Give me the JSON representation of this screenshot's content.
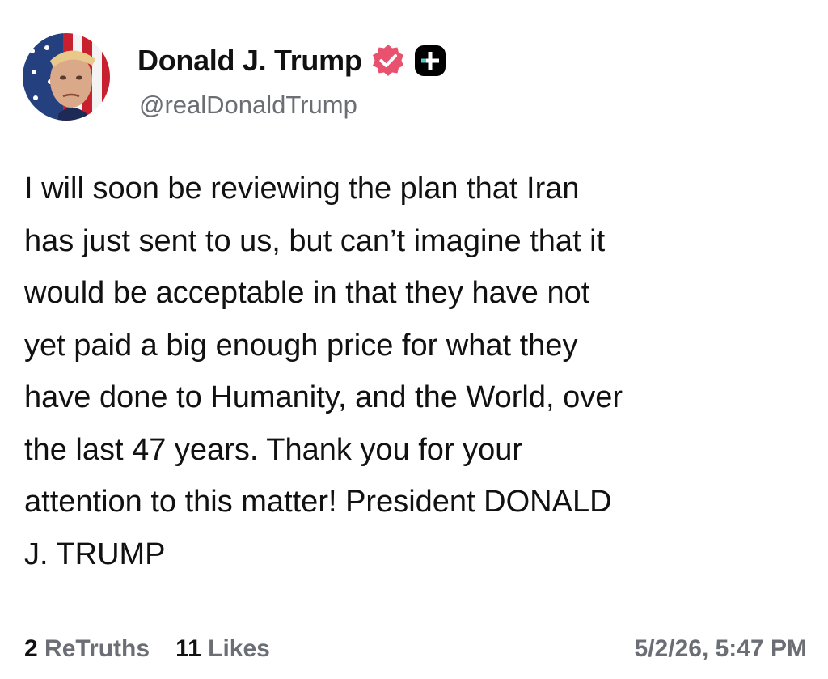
{
  "author": {
    "display_name": "Donald J. Trump",
    "handle": "@realDonaldTrump",
    "verified_badge_icon": "verified-badge-icon",
    "verified_badge_color": "#e8526f",
    "plus_badge_icon": "plus-badge-icon",
    "plus_badge_color": "#000000",
    "plus_badge_accent": "#4fd1c5"
  },
  "post": {
    "lines": [
      "I will soon be reviewing the plan that Iran",
      "has just sent to us, but can’t imagine that it",
      "would be acceptable in that they have not",
      "yet paid a big enough price for what they",
      "have done to Humanity, and the World, over",
      "the last 47 years. Thank you for your",
      "attention to this matter! President DONALD",
      "J. TRUMP"
    ]
  },
  "stats": {
    "retruths_count": "2",
    "retruths_label": "ReTruths",
    "likes_count": "11",
    "likes_label": "Likes"
  },
  "timestamp": "5/2/26, 5:47 PM"
}
